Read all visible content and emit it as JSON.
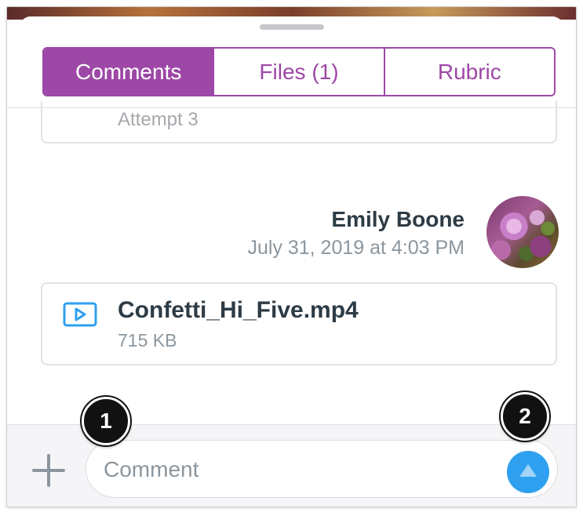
{
  "tabs": [
    {
      "label": "Comments",
      "active": true
    },
    {
      "label": "Files (1)",
      "active": false
    },
    {
      "label": "Rubric",
      "active": false
    }
  ],
  "previous_comment": {
    "attempt_label": "Attempt 3"
  },
  "comment": {
    "author": "Emily Boone",
    "timestamp": "July 31, 2019 at 4:03 PM",
    "attachment": {
      "icon": "video-file-icon",
      "name": "Confetti_Hi_Five.mp4",
      "size": "715 KB"
    }
  },
  "composer": {
    "add_icon": "plus-icon",
    "placeholder": "Comment",
    "send_icon": "send-arrow-icon"
  },
  "callouts": [
    "1",
    "2"
  ],
  "colors": {
    "accent": "#9d48a6",
    "send_button": "#2fa0f0",
    "text_dark": "#2d3b45",
    "text_muted": "#8b969e"
  }
}
